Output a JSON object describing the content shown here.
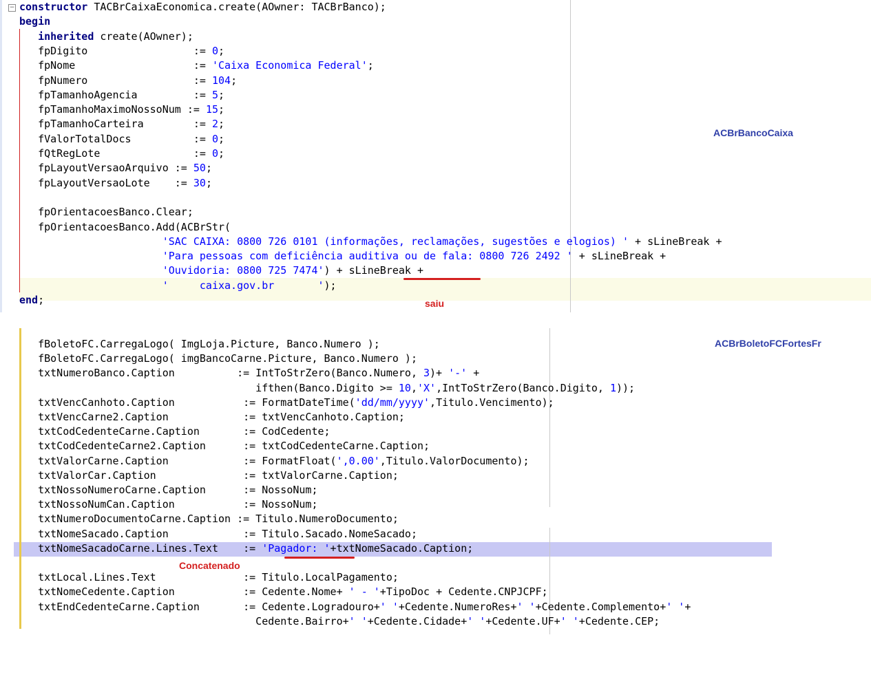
{
  "colors": {
    "keyword": "#000080",
    "string": "#0000ff",
    "number": "#0000ff",
    "annotation_blue": "#2f3fa8",
    "annotation_red": "#d42020",
    "selection": "#c8c8f4",
    "current_line": "#fbfbe6",
    "gutter_change": "#e8c94d"
  },
  "top_editor": {
    "fold_icon": "minus-box-icon",
    "lines": [
      [
        {
          "t": "constructor",
          "c": "kw"
        },
        {
          "t": " TACBrCaixaEconomica.create(AOwner: TACBrBanco);"
        }
      ],
      [
        {
          "t": "begin",
          "c": "kw"
        }
      ],
      [
        {
          "t": "   "
        },
        {
          "t": "inherited",
          "c": "kw"
        },
        {
          "t": " create(AOwner);"
        }
      ],
      [
        {
          "t": "   fpDigito                 := "
        },
        {
          "t": "0",
          "c": "num"
        },
        {
          "t": ";"
        }
      ],
      [
        {
          "t": "   fpNome                   := "
        },
        {
          "t": "'Caixa Economica Federal'",
          "c": "str"
        },
        {
          "t": ";"
        }
      ],
      [
        {
          "t": "   fpNumero                 := "
        },
        {
          "t": "104",
          "c": "num"
        },
        {
          "t": ";"
        }
      ],
      [
        {
          "t": "   fpTamanhoAgencia         := "
        },
        {
          "t": "5",
          "c": "num"
        },
        {
          "t": ";"
        }
      ],
      [
        {
          "t": "   fpTamanhoMaximoNossoNum := "
        },
        {
          "t": "15",
          "c": "num"
        },
        {
          "t": ";"
        }
      ],
      [
        {
          "t": "   fpTamanhoCarteira        := "
        },
        {
          "t": "2",
          "c": "num"
        },
        {
          "t": ";"
        }
      ],
      [
        {
          "t": "   fValorTotalDocs          := "
        },
        {
          "t": "0",
          "c": "num"
        },
        {
          "t": ";"
        }
      ],
      [
        {
          "t": "   fQtRegLote               := "
        },
        {
          "t": "0",
          "c": "num"
        },
        {
          "t": ";"
        }
      ],
      [
        {
          "t": "   fpLayoutVersaoArquivo := "
        },
        {
          "t": "50",
          "c": "num"
        },
        {
          "t": ";"
        }
      ],
      [
        {
          "t": "   fpLayoutVersaoLote    := "
        },
        {
          "t": "30",
          "c": "num"
        },
        {
          "t": ";"
        }
      ],
      [],
      [
        {
          "t": "   fpOrientacoesBanco.Clear;"
        }
      ],
      [
        {
          "t": "   fpOrientacoesBanco.Add(ACBrStr("
        }
      ],
      [
        {
          "t": "                       "
        },
        {
          "t": "'SAC CAIXA: 0800 726 0101 (informações, reclamações, sugestões e elogios) '",
          "c": "str"
        },
        {
          "t": " + sLineBreak +"
        }
      ],
      [
        {
          "t": "                       "
        },
        {
          "t": "'Para pessoas com deficiência auditiva ou de fala: 0800 726 2492 '",
          "c": "str"
        },
        {
          "t": " + sLineBreak +"
        }
      ],
      [
        {
          "t": "                       "
        },
        {
          "t": "'Ouvidoria: 0800 725 7474'",
          "c": "str"
        },
        {
          "t": ") + sLineBreak +"
        }
      ],
      [
        {
          "t": "                       "
        },
        {
          "t": "'     caixa.gov.br       '",
          "c": "str"
        },
        {
          "t": ");"
        }
      ],
      [
        {
          "t": "end",
          "c": "kw"
        },
        {
          "t": ";"
        }
      ]
    ],
    "annotation_label": "ACBrBancoCaixa",
    "annotation_note": "saiu"
  },
  "bottom_editor": {
    "lines": [
      [
        {
          "t": "   fBoletoFC.CarregaLogo( ImgLoja.Picture, Banco.Numero );"
        }
      ],
      [
        {
          "t": "   fBoletoFC.CarregaLogo( imgBancoCarne.Picture, Banco.Numero );"
        }
      ],
      [
        {
          "t": "   txtNumeroBanco.Caption          := IntToStrZero(Banco.Numero, "
        },
        {
          "t": "3",
          "c": "num"
        },
        {
          "t": ")+ "
        },
        {
          "t": "'-'",
          "c": "str"
        },
        {
          "t": " +"
        }
      ],
      [
        {
          "t": "                                      ifthen(Banco.Digito >= "
        },
        {
          "t": "10",
          "c": "num"
        },
        {
          "t": ","
        },
        {
          "t": "'X'",
          "c": "str"
        },
        {
          "t": ",IntToStrZero(Banco.Digito, "
        },
        {
          "t": "1",
          "c": "num"
        },
        {
          "t": "));"
        }
      ],
      [
        {
          "t": "   txtVencCanhoto.Caption           := FormatDateTime("
        },
        {
          "t": "'dd/mm/yyyy'",
          "c": "str"
        },
        {
          "t": ",Titulo.Vencimento);"
        }
      ],
      [
        {
          "t": "   txtVencCarne2.Caption            := txtVencCanhoto.Caption;"
        }
      ],
      [
        {
          "t": "   txtCodCedenteCarne.Caption       := CodCedente;"
        }
      ],
      [
        {
          "t": "   txtCodCedenteCarne2.Caption      := txtCodCedenteCarne.Caption;"
        }
      ],
      [
        {
          "t": "   txtValorCarne.Caption            := FormatFloat("
        },
        {
          "t": "',0.00'",
          "c": "str"
        },
        {
          "t": ",Titulo.ValorDocumento);"
        }
      ],
      [
        {
          "t": "   txtValorCar.Caption              := txtValorCarne.Caption;"
        }
      ],
      [
        {
          "t": "   txtNossoNumeroCarne.Caption      := NossoNum;"
        }
      ],
      [
        {
          "t": "   txtNossoNumCan.Caption           := NossoNum;"
        }
      ],
      [
        {
          "t": "   txtNumeroDocumentoCarne.Caption := Titulo.NumeroDocumento;"
        }
      ],
      [
        {
          "t": "   txtNomeSacado.Caption            := Titulo.Sacado.NomeSacado;"
        }
      ],
      [
        {
          "t": "   txtNomeSacadoCarne.Lines.Text    := "
        },
        {
          "t": "'Pagador: '",
          "c": "str"
        },
        {
          "t": "+txtNomeSacado.Caption;"
        }
      ],
      [],
      [
        {
          "t": "   txtLocal.Lines.Text              := Titulo.LocalPagamento;"
        }
      ],
      [
        {
          "t": "   txtNomeCedente.Caption           := Cedente.Nome+ "
        },
        {
          "t": "' - '",
          "c": "str"
        },
        {
          "t": "+TipoDoc + Cedente.CNPJCPF;"
        }
      ],
      [
        {
          "t": "   txtEndCedenteCarne.Caption       := Cedente.Logradouro+"
        },
        {
          "t": "' '",
          "c": "str"
        },
        {
          "t": "+Cedente.NumeroRes+"
        },
        {
          "t": "' '",
          "c": "str"
        },
        {
          "t": "+Cedente.Complemento+"
        },
        {
          "t": "' '",
          "c": "str"
        },
        {
          "t": "+"
        }
      ],
      [
        {
          "t": "                                      Cedente.Bairro+"
        },
        {
          "t": "' '",
          "c": "str"
        },
        {
          "t": "+Cedente.Cidade+"
        },
        {
          "t": "' '",
          "c": "str"
        },
        {
          "t": "+Cedente.UF+"
        },
        {
          "t": "' '",
          "c": "str"
        },
        {
          "t": "+Cedente.CEP;"
        }
      ]
    ],
    "annotation_label": "ACBrBoletoFCFortesFr",
    "annotation_note": "Concatenado"
  }
}
